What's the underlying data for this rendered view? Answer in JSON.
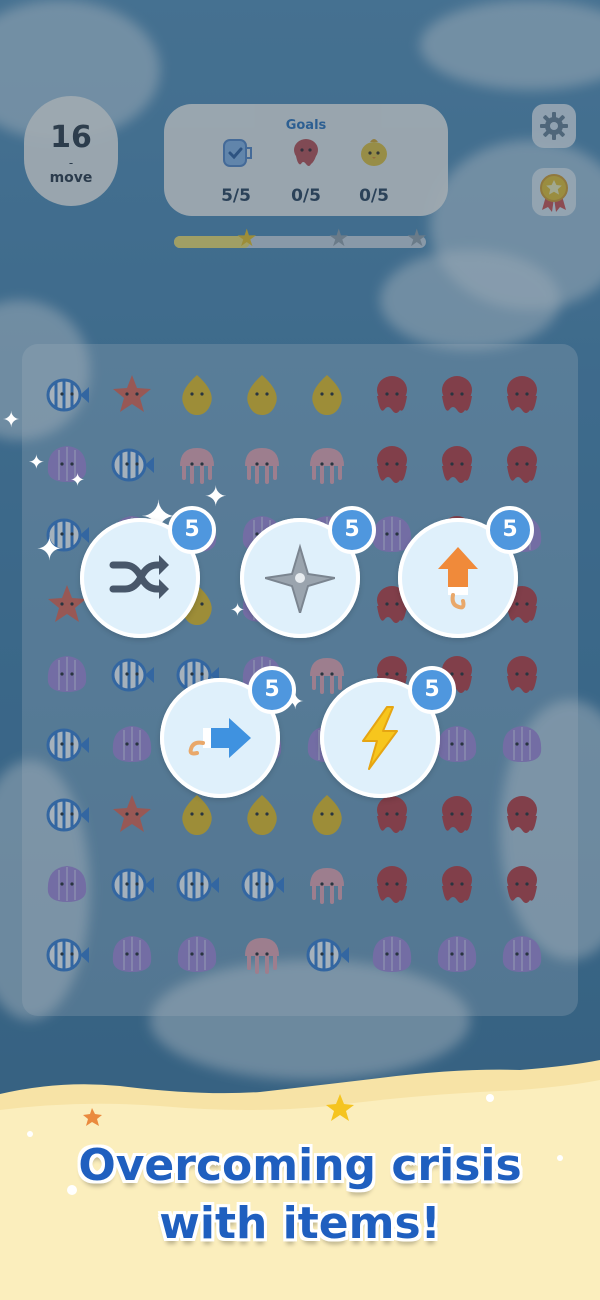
{
  "hud": {
    "moves": {
      "count": "16",
      "dash": "-",
      "label": "move"
    },
    "goals": {
      "title": "Goals",
      "items": [
        {
          "icon": "clock-cup-icon",
          "count": "5/5"
        },
        {
          "icon": "red-octopus-icon",
          "count": "0/5"
        },
        {
          "icon": "yellow-chick-icon",
          "count": "0/5"
        }
      ]
    },
    "progress": {
      "fraction": 0.3,
      "stars_earned": 1,
      "stars_total": 3
    },
    "settings_icon": "gear-icon",
    "ranking_icon": "medal-icon"
  },
  "board": {
    "rows": [
      [
        "fish",
        "starfish",
        "drop",
        "drop",
        "drop",
        "octopus",
        "octopus",
        "octopus"
      ],
      [
        "shell",
        "fish",
        "jelly",
        "jelly",
        "jelly",
        "octopus",
        "octopus",
        "octopus"
      ],
      [
        "fish",
        "shell",
        "shell",
        "shell",
        "shell",
        "shell",
        "octopus",
        "shell"
      ],
      [
        "starfish",
        "starfish",
        "drop",
        "shell",
        "shell",
        "octopus",
        "octopus",
        "octopus"
      ],
      [
        "shell",
        "fish",
        "fish",
        "shell",
        "jelly",
        "octopus",
        "octopus",
        "octopus"
      ],
      [
        "fish",
        "shell",
        "shell",
        "shell",
        "shell",
        "shell",
        "shell",
        "shell"
      ],
      [
        "fish",
        "starfish",
        "drop",
        "drop",
        "drop",
        "octopus",
        "octopus",
        "octopus"
      ],
      [
        "shell",
        "fish",
        "fish",
        "fish",
        "jelly",
        "octopus",
        "octopus",
        "octopus"
      ],
      [
        "fish",
        "shell",
        "shell",
        "jelly",
        "fish",
        "shell",
        "shell",
        "shell"
      ]
    ],
    "colors": {
      "fish": "#3b7fd1",
      "starfish": "#e8664f",
      "drop": "#f2c21c",
      "jelly": "#f1a8b0",
      "octopus": "#c23b3b",
      "shell": "#a98ad6"
    }
  },
  "items": [
    {
      "name": "shuffle",
      "icon": "shuffle-icon",
      "count": "5"
    },
    {
      "name": "shuriken",
      "icon": "shuriken-icon",
      "count": "5"
    },
    {
      "name": "rocket",
      "icon": "rocket-icon",
      "count": "5"
    },
    {
      "name": "horizontal-rocket",
      "icon": "rocket-right-icon",
      "count": "5"
    },
    {
      "name": "lightning",
      "icon": "lightning-icon",
      "count": "5"
    }
  ],
  "banner": {
    "line1": "Overcoming crisis",
    "line2": "with items!"
  }
}
